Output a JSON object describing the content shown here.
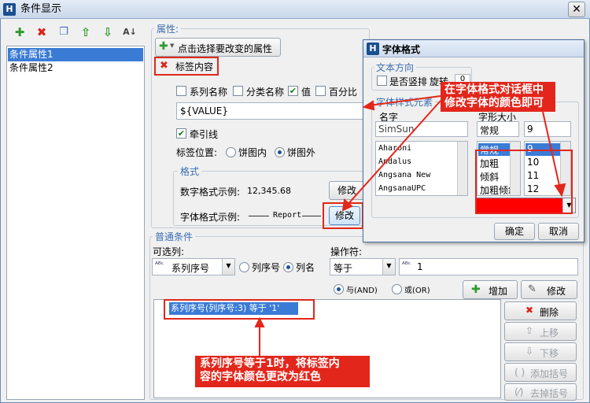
{
  "window": {
    "title": "条件显示",
    "app_icon": "H"
  },
  "left_panel": {
    "items": [
      "条件属性1",
      "条件属性2"
    ],
    "selected_index": 0
  },
  "properties": {
    "group_label": "属性:",
    "add_button_label": "点击选择要改变的属性",
    "tag_label": "标签内容",
    "checks": [
      {
        "label": "系列名称",
        "checked": false
      },
      {
        "label": "分类名称",
        "checked": false
      },
      {
        "label": "值",
        "checked": true
      },
      {
        "label": "百分比",
        "checked": false
      }
    ],
    "value_text": "${VALUE}",
    "leader_line_label": "牵引线",
    "label_position_label": "标签位置:",
    "position_options": [
      {
        "label": "饼图内",
        "selected": false
      },
      {
        "label": "饼图外",
        "selected": true
      }
    ],
    "format_group_label": "格式",
    "number_format_label": "数字格式示例:",
    "number_format_value": "12,345.68",
    "font_format_label": "字体格式示例:",
    "font_sample": "Report",
    "modify_label": "修改"
  },
  "conditions": {
    "group_label": "普通条件",
    "column_label": "可选列:",
    "operator_label": "操作符:",
    "column_value": "系列序号",
    "column_mode_options": [
      {
        "label": "列序号",
        "selected": false
      },
      {
        "label": "列名",
        "selected": true
      }
    ],
    "operator_value": "等于",
    "operand_value": "1",
    "logic_options": [
      {
        "label": "与(AND)",
        "selected": true
      },
      {
        "label": "或(OR)",
        "selected": false
      }
    ],
    "add_button": "增加",
    "modify_button": "修改",
    "condition_item": "系列序号(列序号:3) 等于 '1'",
    "side_buttons": [
      {
        "label": "删除",
        "icon": "delete-icon",
        "enabled": true
      },
      {
        "label": "上移",
        "icon": "arrow-up-icon",
        "enabled": false
      },
      {
        "label": "下移",
        "icon": "arrow-down-icon",
        "enabled": false
      },
      {
        "label": "添加括号",
        "icon": "parentheses-icon",
        "enabled": false
      },
      {
        "label": "去掉括号",
        "icon": "remove-parentheses-icon",
        "enabled": false
      }
    ]
  },
  "font_dialog": {
    "title": "字体格式",
    "direction_group": "文本方向",
    "vertical_label": "是否竖排",
    "rotation_label": "旋转",
    "rotation_value": "0",
    "style_group": "字体样式元素",
    "name_header": "名字",
    "name_value": "SimSun",
    "font_list": [
      "Aharoni",
      "Andalus",
      "Angsana New",
      "AngsanaUPC"
    ],
    "style_header": "字形大小",
    "style_value": "常规",
    "size_value": "9",
    "style_list": [
      "常规",
      "加粗",
      "倾斜",
      "加粗倾斜"
    ],
    "style_selected": 0,
    "size_list": [
      "9",
      "10",
      "11",
      "12"
    ],
    "size_selected": 0,
    "color_value": "#ff0000",
    "ok_button": "确定",
    "cancel_button": "取消"
  },
  "annotations": {
    "dialog_note": "在字体格式对话框中\n修改字体的颜色即可",
    "condition_note": "系列序号等于1时，将标签内\n容的字体颜色更改为红色"
  },
  "colors": {
    "accent": "#3a7bd5",
    "highlight": "#e3261b",
    "group_label": "#3a6fb0"
  }
}
